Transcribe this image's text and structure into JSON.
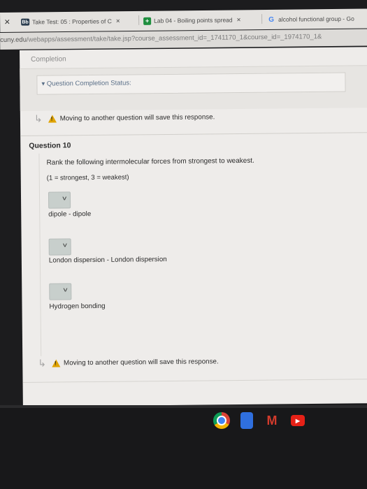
{
  "browser": {
    "window_close": "×",
    "tabs": [
      {
        "favicon": "Bb",
        "label": "Take Test: 05 : Properties of C",
        "close": "×"
      },
      {
        "favicon": "+",
        "label": "Lab 04 - Boiling points spread",
        "close": "×"
      },
      {
        "favicon": "G",
        "label": "alcohol functional group - Go"
      }
    ],
    "address": {
      "host": "cuny.edu",
      "path": "/webapps/assessment/take/take.jsp?course_assessment_id=_1741170_1&course_id=_1974170_1&"
    }
  },
  "page": {
    "completion_label": "Completion",
    "completion_status": "▾ Question Completion Status:",
    "warning_text": "Moving to another question will save this response.",
    "question_title": "Question 10",
    "prompt": "Rank the following intermolecular forces from strongest to weakest.",
    "scale": "(1 = strongest, 3 = weakest)",
    "items": [
      {
        "label": "dipole - dipole",
        "selected": ""
      },
      {
        "label": "London dispersion - London dispersion",
        "selected": ""
      },
      {
        "label": "Hydrogen bonding",
        "selected": ""
      }
    ],
    "warning_text_bottom": "Moving to another question will save this response."
  },
  "dock": {
    "apps": [
      "chrome-icon",
      "docs-icon",
      "gmail-icon",
      "youtube-icon"
    ],
    "gmail_glyph": "M",
    "youtube_glyph": "▶"
  },
  "colors": {
    "page_bg": "#eeecea",
    "warning": "#e0a300",
    "select_bg": "#c8cfcc"
  }
}
